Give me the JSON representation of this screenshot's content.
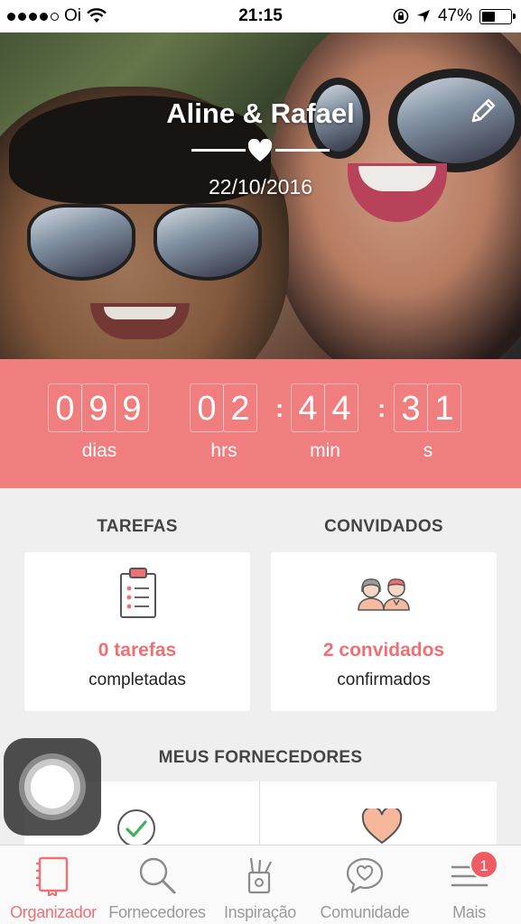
{
  "status_bar": {
    "carrier": "Oi",
    "time": "21:15",
    "battery": "47%",
    "battery_level": 0.47
  },
  "hero": {
    "couple_name": "Aline & Rafael",
    "wedding_date": "22/10/2016",
    "edit_icon": "pencil-icon",
    "divider_icon": "heart-icon"
  },
  "countdown": {
    "days_digits": [
      "0",
      "9",
      "9"
    ],
    "hours_digits": [
      "0",
      "2"
    ],
    "minutes_digits": [
      "4",
      "4"
    ],
    "seconds_digits": [
      "3",
      "1"
    ],
    "days_label": "dias",
    "hours_label": "hrs",
    "minutes_label": "min",
    "seconds_label": "s"
  },
  "tasks": {
    "title": "TAREFAS",
    "count": "0 tarefas",
    "subtitle": "completadas",
    "icon": "clipboard-checklist-icon"
  },
  "guests": {
    "title": "CONVIDADOS",
    "count": "2 convidados",
    "subtitle": "confirmados",
    "icon": "couple-icon"
  },
  "suppliers": {
    "title": "MEUS FORNECEDORES",
    "left_icon": "check-circle-icon",
    "right_icon": "heart-icon"
  },
  "tabbar": {
    "items": [
      {
        "label": "Organizador",
        "icon": "notebook-icon",
        "active": true
      },
      {
        "label": "Fornecedores",
        "icon": "search-icon",
        "active": false
      },
      {
        "label": "Inspiração",
        "icon": "craft-tools-icon",
        "active": false
      },
      {
        "label": "Comunidade",
        "icon": "chat-heart-icon",
        "active": false
      },
      {
        "label": "Mais",
        "icon": "menu-icon",
        "active": false
      }
    ],
    "badge_count": "1"
  },
  "colors": {
    "accent": "#f17e7e",
    "accent_text": "#ef6f72",
    "background": "#efefef"
  }
}
